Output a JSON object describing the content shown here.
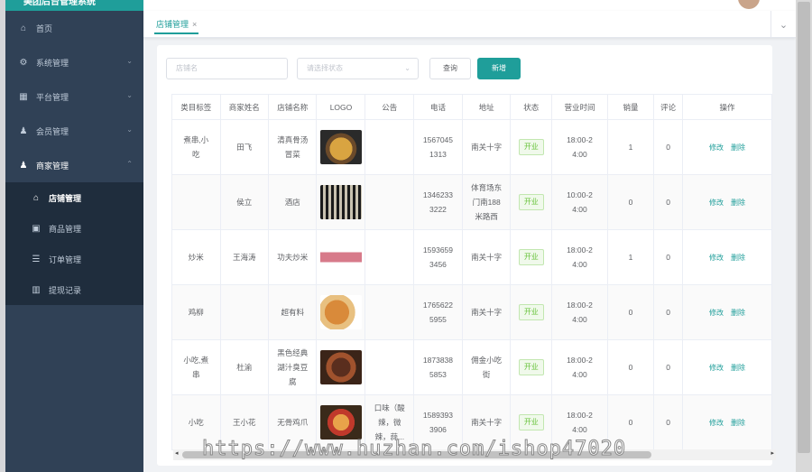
{
  "app": {
    "title": "美团后台管理系统"
  },
  "sidebar": {
    "items": [
      {
        "label": "首页",
        "icon": "home-icon"
      },
      {
        "label": "系统管理",
        "icon": "gear-icon"
      },
      {
        "label": "平台管理",
        "icon": "grid-icon"
      },
      {
        "label": "会员管理",
        "icon": "user-icon"
      },
      {
        "label": "商家管理",
        "icon": "user-icon"
      }
    ],
    "submenu": [
      {
        "label": "店铺管理",
        "icon": "home-icon"
      },
      {
        "label": "商品管理",
        "icon": "image-icon"
      },
      {
        "label": "订单管理",
        "icon": "list-icon"
      },
      {
        "label": "提现记录",
        "icon": "bar-chart-icon"
      }
    ]
  },
  "tabs": [
    {
      "label": "店铺管理",
      "close": "×"
    }
  ],
  "filters": {
    "shop_name_placeholder": "店铺名",
    "status_placeholder": "请选择状态",
    "query_label": "查询",
    "add_label": "新增"
  },
  "table": {
    "headers": [
      "类目标签",
      "商家姓名",
      "店铺名称",
      "LOGO",
      "公告",
      "电话",
      "地址",
      "状态",
      "营业时间",
      "销量",
      "评论",
      "操作"
    ],
    "rows": [
      {
        "tag": "煮串,小\n吃",
        "owner": "田飞",
        "shop": "清真骨汤\n冒菜",
        "notice": "",
        "phone": "1567045\n1313",
        "address": "南关十字",
        "status": "开业",
        "hours": "18:00-2\n4:00",
        "sales": "1",
        "reviews": "0"
      },
      {
        "tag": "",
        "owner": "侯立",
        "shop": "酒店",
        "notice": "",
        "phone": "1346233\n3222",
        "address": "体育场东\n门南188\n米路西",
        "status": "开业",
        "hours": "10:00-2\n4:00",
        "sales": "0",
        "reviews": "0"
      },
      {
        "tag": "炒米",
        "owner": "王海涛",
        "shop": "功夫炒米",
        "notice": "",
        "phone": "1593659\n3456",
        "address": "南关十字",
        "status": "开业",
        "hours": "18:00-2\n4:00",
        "sales": "1",
        "reviews": "0"
      },
      {
        "tag": "鸡柳",
        "owner": "",
        "shop": "超有料",
        "notice": "",
        "phone": "1765622\n5955",
        "address": "南关十字",
        "status": "开业",
        "hours": "18:00-2\n4:00",
        "sales": "0",
        "reviews": "0"
      },
      {
        "tag": "小吃,煮\n串",
        "owner": "杜渝",
        "shop": "黑色经典\n湖汁臭豆\n腐",
        "notice": "",
        "phone": "1873838\n5853",
        "address": "佣金小吃\n街",
        "status": "开业",
        "hours": "18:00-2\n4:00",
        "sales": "0",
        "reviews": "0"
      },
      {
        "tag": "小吃",
        "owner": "王小花",
        "shop": "无骨鸡爪",
        "notice": "口味（酸\n辣，微\n辣，蒜...",
        "phone": "1589393\n3906",
        "address": "南关十字",
        "status": "开业",
        "hours": "18:00-2\n4:00",
        "sales": "0",
        "reviews": "0"
      }
    ],
    "actions": {
      "edit": "修改",
      "delete": "删除"
    }
  },
  "watermark": "https://www.huzhan.com/ishop47020",
  "colors": {
    "accent": "#1f9e9a",
    "sidebar": "#304156",
    "status": "#67c23a"
  }
}
